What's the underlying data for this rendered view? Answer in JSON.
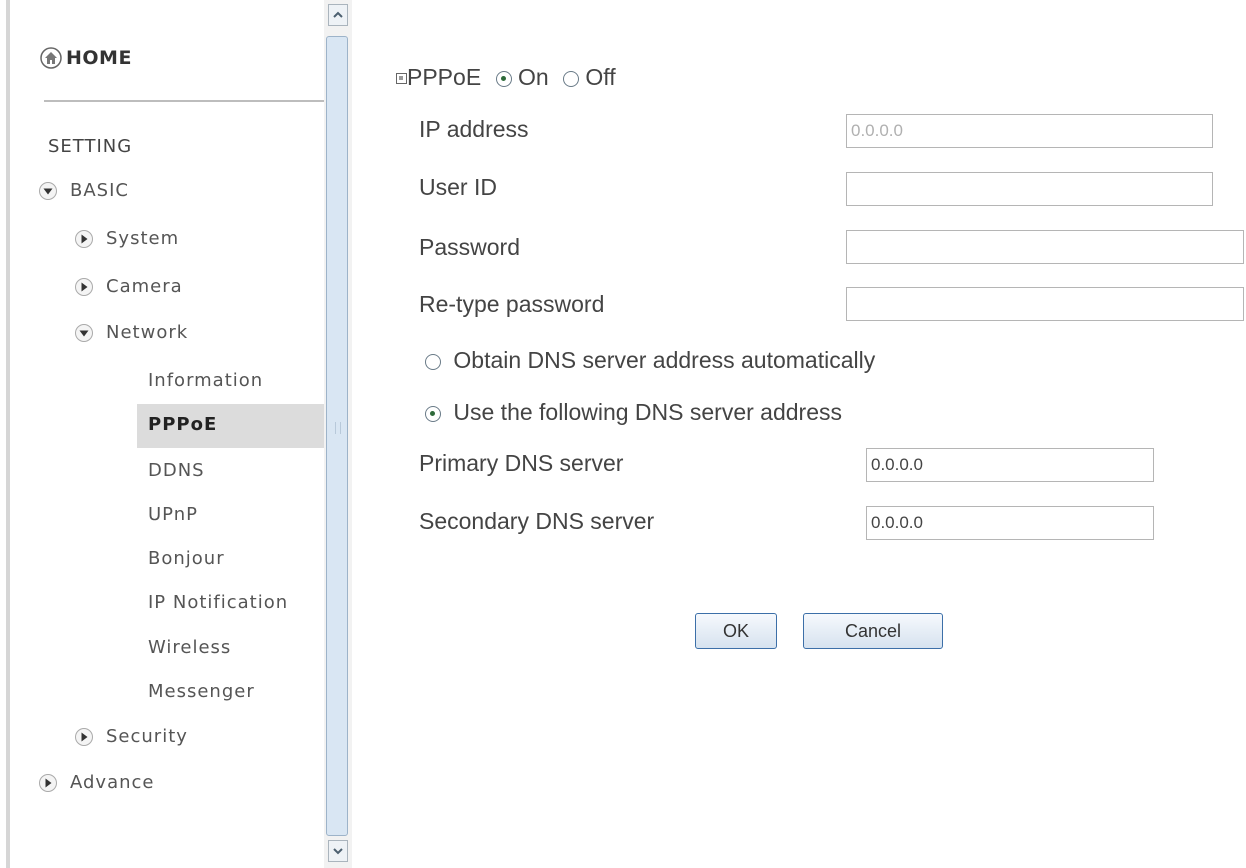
{
  "sidebar": {
    "home": "HOME",
    "setting": "SETTING",
    "basic": "BASIC",
    "system": "System",
    "camera": "Camera",
    "network": "Network",
    "sub_items": [
      "Information",
      "PPPoE",
      "DDNS",
      "UPnP",
      "Bonjour",
      "IP Notification",
      "Wireless",
      "Messenger"
    ],
    "security": "Security",
    "advance": "Advance"
  },
  "form": {
    "pppoe_label": "PPPoE",
    "on_label": "On",
    "off_label": "Off",
    "pppoe_state": "On",
    "ip_label": "IP address",
    "ip_value": "0.0.0.0",
    "user_label": "User ID",
    "user_value": "",
    "password_label": "Password",
    "password_value": "",
    "retype_label": "Re-type password",
    "retype_value": "",
    "dns_auto_label": "Obtain DNS server address automatically",
    "dns_manual_label": "Use the following DNS server address",
    "dns_mode": "manual",
    "primary_dns_label": "Primary DNS server",
    "primary_dns_value": "0.0.0.0",
    "secondary_dns_label": "Secondary DNS server",
    "secondary_dns_value": "0.0.0.0"
  },
  "buttons": {
    "ok": "OK",
    "cancel": "Cancel"
  },
  "colors": {
    "accent": "#3c6fa8",
    "selected_bg": "#dcdcdc"
  }
}
